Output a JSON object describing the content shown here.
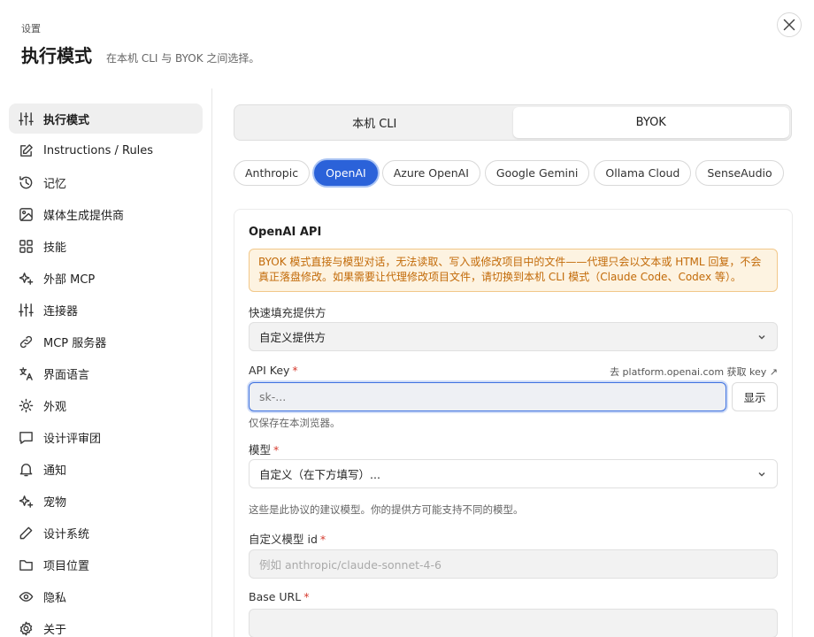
{
  "header": {
    "eyebrow": "设置",
    "title": "执行模式",
    "subtitle": "在本机 CLI 与 BYOK 之间选择。"
  },
  "sidebar": {
    "items": [
      {
        "label": "执行模式",
        "icon": "sliders-icon",
        "active": true
      },
      {
        "label": "Instructions / Rules",
        "icon": "pencil-square-icon"
      },
      {
        "label": "记忆",
        "icon": "history-icon"
      },
      {
        "label": "媒体生成提供商",
        "icon": "image-icon"
      },
      {
        "label": "技能",
        "icon": "grid-icon"
      },
      {
        "label": "外部 MCP",
        "icon": "sparkle-icon"
      },
      {
        "label": "连接器",
        "icon": "sliders-icon"
      },
      {
        "label": "MCP 服务器",
        "icon": "link-icon"
      },
      {
        "label": "界面语言",
        "icon": "translate-icon"
      },
      {
        "label": "外观",
        "icon": "sun-icon"
      },
      {
        "label": "设计评审团",
        "icon": "chat-icon"
      },
      {
        "label": "通知",
        "icon": "bell-icon"
      },
      {
        "label": "宠物",
        "icon": "sparkle-icon"
      },
      {
        "label": "设计系统",
        "icon": "pencil-icon"
      },
      {
        "label": "项目位置",
        "icon": "folder-icon"
      },
      {
        "label": "隐私",
        "icon": "eye-icon"
      },
      {
        "label": "关于",
        "icon": "gear-icon"
      }
    ]
  },
  "mode": {
    "options": [
      "本机 CLI",
      "BYOK"
    ],
    "selected": "BYOK"
  },
  "providers": {
    "items": [
      "Anthropic",
      "OpenAI",
      "Azure OpenAI",
      "Google Gemini",
      "Ollama Cloud",
      "SenseAudio"
    ],
    "selected": "OpenAI"
  },
  "form": {
    "section_title": "OpenAI API",
    "warning_line1": "BYOK 模式直接与模型对话，无法读取、写入或修改项目中的文件——代理只会以文本或 HTML 回复，不会",
    "warning_line2": "真正落盘修改。如果需要让代理修改项目文件，请切换到本机 CLI 模式（Claude Code、Codex 等）。",
    "quick_fill_label": "快速填充提供方",
    "quick_fill_value": "自定义提供方",
    "api_key_label": "API Key",
    "api_key_link": "去 platform.openai.com 获取 key ↗",
    "api_key_placeholder": "sk-...",
    "api_key_value": "",
    "show_button": "显示",
    "api_key_hint": "仅保存在本浏览器。",
    "model_label": "模型",
    "model_value": "自定义（在下方填写）...",
    "model_hint": "这些是此协议的建议模型。你的提供方可能支持不同的模型。",
    "custom_model_label": "自定义模型 id",
    "custom_model_placeholder": "例如 anthropic/claude-sonnet-4-6",
    "base_url_label": "Base URL",
    "required_mark": "*"
  },
  "colors": {
    "accent": "#2b62d9",
    "warning_bg": "#fdf3e1",
    "warning_text": "#c26a08",
    "required": "#d63b2f"
  }
}
